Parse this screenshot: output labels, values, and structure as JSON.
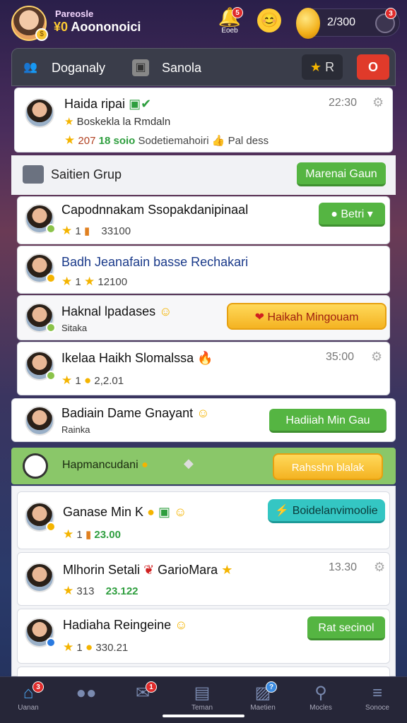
{
  "header": {
    "small_label": "Pareosle",
    "name_prefix": "¥0",
    "name": "Aoononoici",
    "bell_label": "Eoeb",
    "bell_badge": "5",
    "coin_value": "2/300",
    "coin_badge": "3"
  },
  "tabs": [
    {
      "label": "Doganaly",
      "icon": "users-icon"
    },
    {
      "label": "Sanola",
      "icon": "image-icon"
    }
  ],
  "tab_sort_label": "R",
  "close_label": "O",
  "featured": {
    "name": "Haida ripai",
    "sub": "Boskekla la Rmdaln",
    "stars": "207",
    "green": "18 soio",
    "tail": "Sodetiemahoiri",
    "tail2": "Pal dess",
    "time": "22:30"
  },
  "section1": {
    "title": "Saitien Grup",
    "button": "Marenai Gaun"
  },
  "group_rows": [
    {
      "name": "Capodnnakam Ssopakdanipinaal",
      "stat1": "1",
      "stat2": "33100",
      "button": "Betri",
      "btype": "green"
    },
    {
      "name": "Badh Jeanafain basse Rechakari",
      "stat1": "1",
      "stat2": "12100",
      "button": "",
      "btype": ""
    },
    {
      "name": "Haknal lpadases",
      "sub": "Sitaka",
      "button": "Haikah Mingouam",
      "btype": "gold"
    },
    {
      "name": "Ikelaa Haikh Slomalssa",
      "stat1": "1",
      "stat2": "2,2.01",
      "time": "35:00",
      "btype": ""
    },
    {
      "name": "Badiain Dame Gnayant",
      "sub": "Rainka",
      "button": "Hadiiah Min Gau",
      "btype": "green"
    }
  ],
  "section2": {
    "title": "Hapmancudani",
    "button": "Rahsshn blalak"
  },
  "bottom_rows": [
    {
      "name": "Ganase Min K",
      "stat1": "1",
      "stat2": "23.00",
      "button": "Boidelanvimoolie"
    },
    {
      "name": "Mlhorin Setali",
      "name2": "GarioMara",
      "stat1": "313",
      "stat2": "23.122",
      "time": "13.30"
    },
    {
      "name": "Hadiaha Reingeine",
      "stat1": "1",
      "stat2": "330.21",
      "button": "Rat secinol"
    }
  ],
  "nav": [
    {
      "label": "Uanan",
      "icon": "home-icon",
      "badge": "3"
    },
    {
      "label": "",
      "icon": "chat-icon",
      "badge": ""
    },
    {
      "label": "",
      "icon": "mail-icon",
      "badge": "1"
    },
    {
      "label": "Teman",
      "icon": "bag-icon",
      "badge": ""
    },
    {
      "label": "Maetien",
      "icon": "image-icon",
      "badge": "?"
    },
    {
      "label": "Mocles",
      "icon": "search-icon",
      "badge": ""
    },
    {
      "label": "Sonoce",
      "icon": "menu-icon",
      "badge": ""
    }
  ]
}
